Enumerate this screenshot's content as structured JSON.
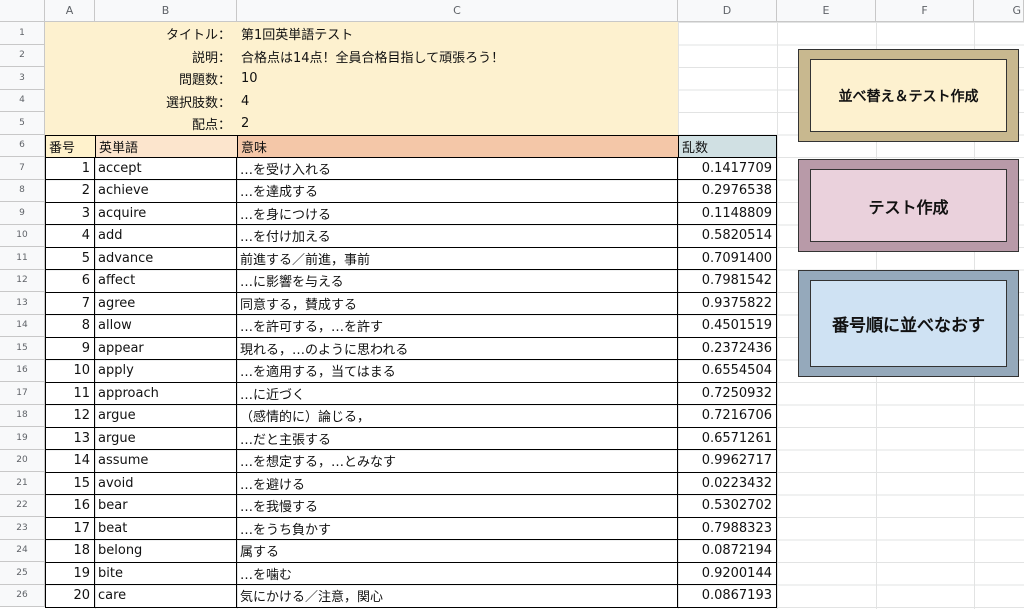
{
  "columns": [
    "A",
    "B",
    "C",
    "D",
    "E",
    "F",
    "G"
  ],
  "rows": [
    "1",
    "2",
    "3",
    "4",
    "5",
    "6",
    "7",
    "8",
    "9",
    "10",
    "11",
    "12",
    "13",
    "14",
    "15",
    "16",
    "17",
    "18",
    "19",
    "20",
    "21",
    "22",
    "23",
    "24",
    "25",
    "26"
  ],
  "info": [
    {
      "label": "タイトル：",
      "value": "第1回英単語テスト"
    },
    {
      "label": "説明：",
      "value": "合格点は14点！全員合格目指して頑張ろう！"
    },
    {
      "label": "問題数：",
      "value": "10"
    },
    {
      "label": "選択肢数：",
      "value": "4"
    },
    {
      "label": "配点：",
      "value": "2"
    }
  ],
  "table_header": {
    "no": "番号",
    "word": "英単語",
    "meaning": "意味",
    "rand": "乱数"
  },
  "table_rows": [
    {
      "no": "1",
      "word": "accept",
      "meaning": "…を受け入れる",
      "rand": "0.1417709"
    },
    {
      "no": "2",
      "word": "achieve",
      "meaning": "…を達成する",
      "rand": "0.2976538"
    },
    {
      "no": "3",
      "word": "acquire",
      "meaning": "…を身につける",
      "rand": "0.1148809"
    },
    {
      "no": "4",
      "word": "add",
      "meaning": "…を付け加える",
      "rand": "0.5820514"
    },
    {
      "no": "5",
      "word": "advance",
      "meaning": "前進する／前進，事前",
      "rand": "0.7091400"
    },
    {
      "no": "6",
      "word": "affect",
      "meaning": "…に影響を与える",
      "rand": "0.7981542"
    },
    {
      "no": "7",
      "word": "agree",
      "meaning": "同意する，賛成する",
      "rand": "0.9375822"
    },
    {
      "no": "8",
      "word": "allow",
      "meaning": "…を許可する，…を許す",
      "rand": "0.4501519"
    },
    {
      "no": "9",
      "word": "appear",
      "meaning": "現れる，…のように思われる",
      "rand": "0.2372436"
    },
    {
      "no": "10",
      "word": "apply",
      "meaning": "…を適用する，当てはまる",
      "rand": "0.6554504"
    },
    {
      "no": "11",
      "word": "approach",
      "meaning": "…に近づく",
      "rand": "0.7250932"
    },
    {
      "no": "12",
      "word": "argue",
      "meaning": "（感情的に）論じる，",
      "rand": "0.7216706"
    },
    {
      "no": "13",
      "word": "argue",
      "meaning": "…だと主張する",
      "rand": "0.6571261"
    },
    {
      "no": "14",
      "word": "assume",
      "meaning": "…を想定する，…とみなす",
      "rand": "0.9962717"
    },
    {
      "no": "15",
      "word": "avoid",
      "meaning": "…を避ける",
      "rand": "0.0223432"
    },
    {
      "no": "16",
      "word": "bear",
      "meaning": "…を我慢する",
      "rand": "0.5302702"
    },
    {
      "no": "17",
      "word": "beat",
      "meaning": "…をうち負かす",
      "rand": "0.7988323"
    },
    {
      "no": "18",
      "word": "belong",
      "meaning": "属する",
      "rand": "0.0872194"
    },
    {
      "no": "19",
      "word": "bite",
      "meaning": "…を噛む",
      "rand": "0.9200144"
    },
    {
      "no": "20",
      "word": "care",
      "meaning": "気にかける／注意，関心",
      "rand": "0.0867193"
    }
  ],
  "buttons": {
    "sort_test": {
      "label": "並べ替え＆テスト作成",
      "color": "#fdf1cf"
    },
    "make_test": {
      "label": "テスト作成",
      "color": "#ead1dc"
    },
    "sort_by_no": {
      "label": "番号順に並べなおす",
      "color": "#cfe2f3"
    }
  },
  "colors": {
    "info_band": "#fdf1cf",
    "hdr_no": "#fff2cc",
    "hdr_word": "#fce5cd",
    "hdr_meaning": "#f4c7a8",
    "hdr_rand": "#d0e0e3"
  }
}
